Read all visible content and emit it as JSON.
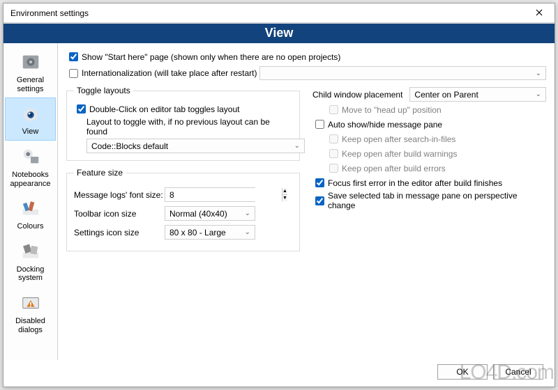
{
  "window": {
    "title": "Environment settings"
  },
  "header": {
    "title": "View"
  },
  "sidebar": {
    "items": [
      {
        "label": "General settings"
      },
      {
        "label": "View"
      },
      {
        "label": "Notebooks appearance"
      },
      {
        "label": "Colours"
      },
      {
        "label": "Docking system"
      },
      {
        "label": "Disabled dialogs"
      }
    ]
  },
  "main": {
    "show_start_here": {
      "checked": true,
      "label": "Show \"Start here\" page (shown only when there are no open projects)"
    },
    "internationalization": {
      "checked": false,
      "label": "Internationalization (will take place after restart)"
    },
    "toggle_layouts": {
      "legend": "Toggle layouts",
      "dbl_click": {
        "checked": true,
        "label": "Double-Click on editor tab toggles layout"
      },
      "fallback_label": "Layout to toggle with, if no previous layout can be found",
      "fallback_value": "Code::Blocks default"
    },
    "feature_size": {
      "legend": "Feature size",
      "msg_font_label": "Message logs' font size:",
      "msg_font_value": "8",
      "toolbar_label": "Toolbar icon size",
      "toolbar_value": "Normal (40x40)",
      "settings_label": "Settings icon size",
      "settings_value": "80 x 80 - Large"
    },
    "right": {
      "child_placement_label": "Child window placement",
      "child_placement_value": "Center on Parent",
      "move_head_up": {
        "checked": false,
        "label": "Move to \"head up\" position",
        "disabled": true
      },
      "auto_show_hide": {
        "checked": false,
        "label": "Auto show/hide message pane"
      },
      "keep_search": {
        "checked": false,
        "label": "Keep open after search-in-files",
        "disabled": true
      },
      "keep_warn": {
        "checked": false,
        "label": "Keep open after build warnings",
        "disabled": true
      },
      "keep_err": {
        "checked": false,
        "label": "Keep open after build errors",
        "disabled": true
      },
      "focus_first": {
        "checked": true,
        "label": "Focus first error in the editor after build finishes"
      },
      "save_tab": {
        "checked": true,
        "label": "Save selected tab in message pane on perspective change"
      }
    }
  },
  "footer": {
    "ok": "OK",
    "cancel": "Cancel"
  },
  "watermark": "LO4D.com"
}
